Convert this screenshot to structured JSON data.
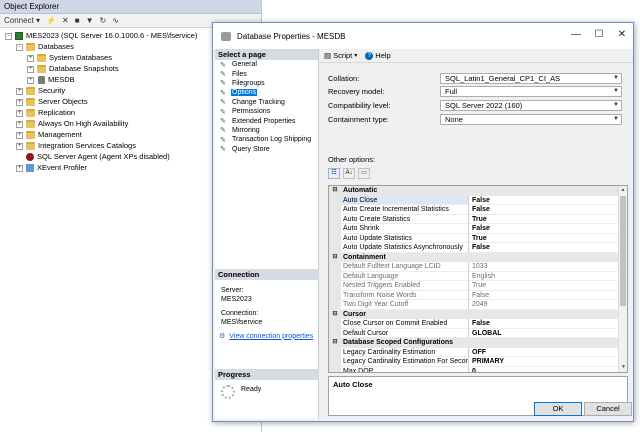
{
  "object_explorer": {
    "title": "Object Explorer",
    "connect_label": "Connect",
    "tree": [
      {
        "label": "MES2023 (SQL Server 16.0.1000.6 - MES\\fservice)",
        "level": 0,
        "expander": "-",
        "icon": "server-icon"
      },
      {
        "label": "Databases",
        "level": 1,
        "expander": "-",
        "icon": "folder-icon"
      },
      {
        "label": "System Databases",
        "level": 2,
        "expander": "+",
        "icon": "folder-icon"
      },
      {
        "label": "Database Snapshots",
        "level": 2,
        "expander": "+",
        "icon": "folder-icon"
      },
      {
        "label": "MESDB",
        "level": 2,
        "expander": "+",
        "icon": "database-icon"
      },
      {
        "label": "Security",
        "level": 1,
        "expander": "+",
        "icon": "folder-icon"
      },
      {
        "label": "Server Objects",
        "level": 1,
        "expander": "+",
        "icon": "folder-icon"
      },
      {
        "label": "Replication",
        "level": 1,
        "expander": "+",
        "icon": "folder-icon"
      },
      {
        "label": "Always On High Availability",
        "level": 1,
        "expander": "+",
        "icon": "folder-icon"
      },
      {
        "label": "Management",
        "level": 1,
        "expander": "+",
        "icon": "folder-icon"
      },
      {
        "label": "Integration Services Catalogs",
        "level": 1,
        "expander": "+",
        "icon": "folder-icon"
      },
      {
        "label": "SQL Server Agent (Agent XPs disabled)",
        "level": 1,
        "expander": "",
        "icon": "agent-icon"
      },
      {
        "label": "XEvent Profiler",
        "level": 1,
        "expander": "+",
        "icon": "xevent-icon"
      }
    ]
  },
  "dialog": {
    "title": "Database Properties - MESDB",
    "select_page_header": "Select a page",
    "pages": [
      "General",
      "Files",
      "Filegroups",
      "Options",
      "Change Tracking",
      "Permissions",
      "Extended Properties",
      "Mirroring",
      "Transaction Log Shipping",
      "Query Store"
    ],
    "selected_page": "Options",
    "connection": {
      "header": "Connection",
      "server_label": "Server:",
      "server_value": "MES2023",
      "connection_label": "Connection:",
      "connection_value": "MES\\fservice",
      "link": "View connection properties"
    },
    "progress": {
      "header": "Progress",
      "status": "Ready"
    },
    "toolbar": {
      "script_label": "Script",
      "help_label": "Help"
    },
    "fields": [
      {
        "label": "Collation:",
        "value": "SQL_Latin1_General_CP1_CI_AS"
      },
      {
        "label": "Recovery model:",
        "value": "Full"
      },
      {
        "label": "Compatibility level:",
        "value": "SQL Server 2022 (160)"
      },
      {
        "label": "Containment type:",
        "value": "None"
      }
    ],
    "other_options_label": "Other options:",
    "grid": [
      {
        "category": "Automatic",
        "rows": [
          {
            "name": "Auto Close",
            "value": "False",
            "bold": true,
            "readonly": false
          },
          {
            "name": "Auto Create Incremental Statistics",
            "value": "False",
            "bold": true,
            "readonly": false
          },
          {
            "name": "Auto Create Statistics",
            "value": "True",
            "bold": true,
            "readonly": false
          },
          {
            "name": "Auto Shrink",
            "value": "False",
            "bold": true,
            "readonly": false
          },
          {
            "name": "Auto Update Statistics",
            "value": "True",
            "bold": true,
            "readonly": false
          },
          {
            "name": "Auto Update Statistics Asynchronously",
            "value": "False",
            "bold": true,
            "readonly": false
          }
        ]
      },
      {
        "category": "Containment",
        "rows": [
          {
            "name": "Default Fulltext Language LCID",
            "value": "1033",
            "bold": false,
            "readonly": true
          },
          {
            "name": "Default Language",
            "value": "English",
            "bold": false,
            "readonly": true
          },
          {
            "name": "Nested Triggers Enabled",
            "value": "True",
            "bold": false,
            "readonly": true
          },
          {
            "name": "Transform Noise Words",
            "value": "False",
            "bold": false,
            "readonly": true
          },
          {
            "name": "Two Digit Year Cutoff",
            "value": "2049",
            "bold": false,
            "readonly": true
          }
        ]
      },
      {
        "category": "Cursor",
        "rows": [
          {
            "name": "Close Cursor on Commit Enabled",
            "value": "False",
            "bold": true,
            "readonly": false
          },
          {
            "name": "Default Cursor",
            "value": "GLOBAL",
            "bold": true,
            "readonly": false
          }
        ]
      },
      {
        "category": "Database Scoped Configurations",
        "rows": [
          {
            "name": "Legacy Cardinality Estimation",
            "value": "OFF",
            "bold": true,
            "readonly": false
          },
          {
            "name": "Legacy Cardinality Estimation For Secondary",
            "value": "PRIMARY",
            "bold": true,
            "readonly": false
          },
          {
            "name": "Max DOP",
            "value": "0",
            "bold": true,
            "readonly": false
          }
        ]
      }
    ],
    "description": "Auto Close",
    "ok_label": "OK",
    "cancel_label": "Cancel"
  }
}
